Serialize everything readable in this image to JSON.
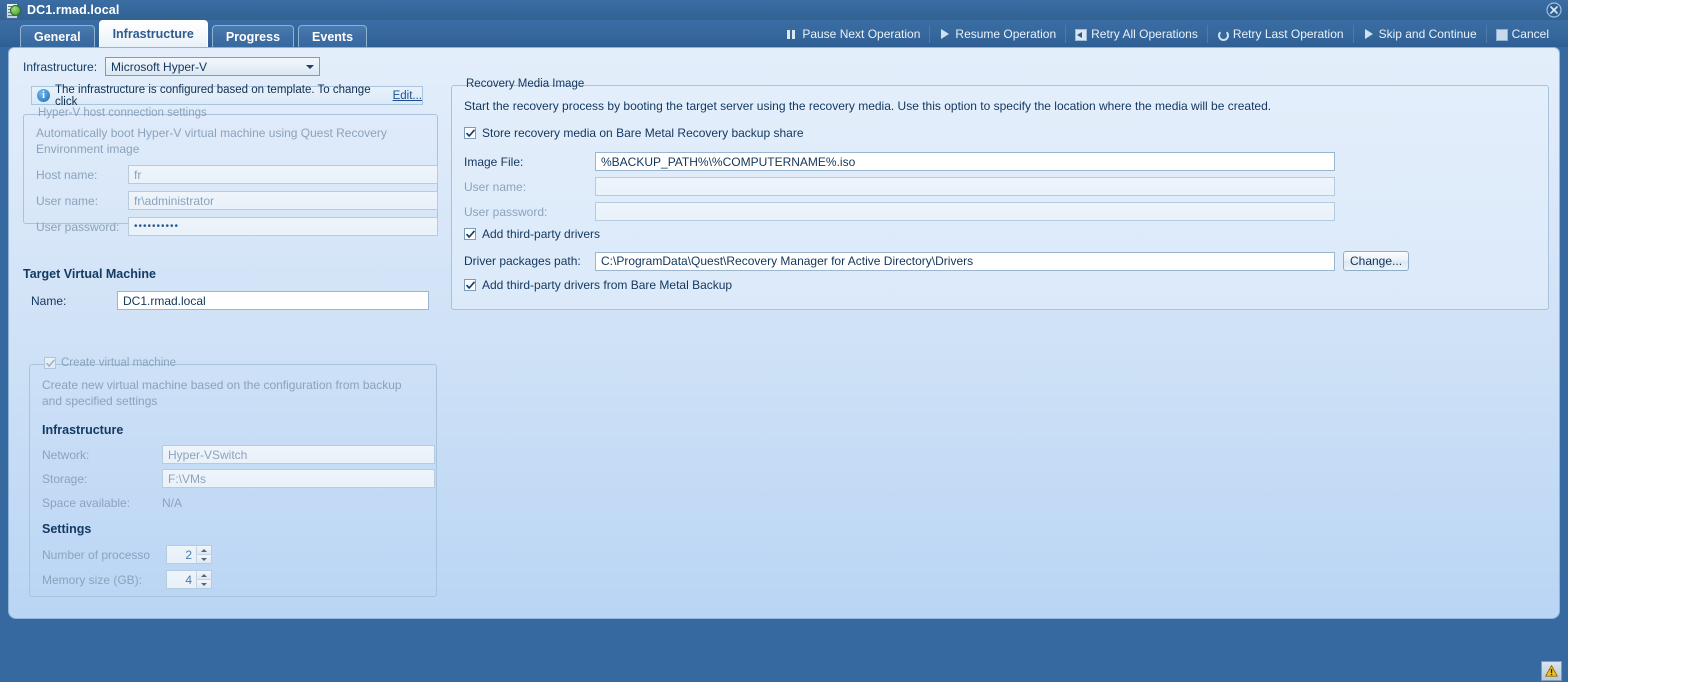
{
  "window": {
    "title": "DC1.rmad.local",
    "icon": "server-globe-icon",
    "close_icon": "close-icon"
  },
  "tabs": [
    {
      "label": "General",
      "active": false
    },
    {
      "label": "Infrastructure",
      "active": true
    },
    {
      "label": "Progress",
      "active": false
    },
    {
      "label": "Events",
      "active": false
    }
  ],
  "toolbar": [
    {
      "label": "Pause Next Operation",
      "icon": "pause-icon"
    },
    {
      "label": "Resume Operation",
      "icon": "play-icon"
    },
    {
      "label": "Retry All Operations",
      "icon": "retry-all-icon"
    },
    {
      "label": "Retry Last Operation",
      "icon": "retry-last-icon"
    },
    {
      "label": "Skip and Continue",
      "icon": "play-icon"
    },
    {
      "label": "Cancel",
      "icon": "cancel-icon"
    }
  ],
  "left": {
    "infrastructure_label": "Infrastructure:",
    "infrastructure_value": "Microsoft Hyper-V",
    "info_text": "The infrastructure is configured based on template. To change click",
    "info_link": "Edit...",
    "hyperv_group": {
      "legend": "Hyper-V host connection settings",
      "description": "Automatically boot Hyper-V virtual machine using Quest Recovery Environment image",
      "fields": [
        {
          "label": "Host name:",
          "value": "fr"
        },
        {
          "label": "User name:",
          "value": "fr\\administrator"
        },
        {
          "label": "User password:",
          "value": "••••••••••"
        }
      ]
    },
    "target_vm_heading": "Target Virtual Machine",
    "name_label": "Name:",
    "name_value": "DC1.rmad.local",
    "create_vm": {
      "legend": "Create virtual machine",
      "checked": true,
      "description": "Create new virtual machine based on the configuration from backup and specified settings",
      "infrastructure_heading": "Infrastructure",
      "network_label": "Network:",
      "network_value": "Hyper-VSwitch",
      "storage_label": "Storage:",
      "storage_value": "F:\\VMs",
      "space_label": "Space available:",
      "space_value": "N/A",
      "settings_heading": "Settings",
      "processors_label": "Number of processo",
      "processors_value": "2",
      "memory_label": "Memory size (GB):",
      "memory_value": "4"
    }
  },
  "right": {
    "legend": "Recovery Media Image",
    "description": "Start the recovery process by booting the target server using the recovery media. Use this option to specify the location where the media will be created.",
    "store_media_checkbox": {
      "label": "Store recovery media on Bare Metal Recovery backup share",
      "checked": true
    },
    "image_file_label": "Image File:",
    "image_file_value": "%BACKUP_PATH%\\%COMPUTERNAME%.iso",
    "user_name_label": "User name:",
    "user_name_value": "",
    "user_password_label": "User password:",
    "user_password_value": "",
    "add_drivers_checkbox": {
      "label": "Add third-party drivers",
      "checked": true
    },
    "driver_path_label": "Driver packages path:",
    "driver_path_value": "C:\\ProgramData\\Quest\\Recovery Manager for Active Directory\\Drivers",
    "change_button": "Change...",
    "add_drivers_bmb_checkbox": {
      "label": "Add third-party drivers from Bare Metal Backup",
      "checked": true
    }
  },
  "statusbar": {
    "warning_icon": "warning-triangle-icon"
  },
  "colors": {
    "chrome": "#36699f",
    "panel": "#d2e3f7",
    "accent_text": "#14375f",
    "link": "#1b4f91",
    "warning": "#f2c216"
  }
}
